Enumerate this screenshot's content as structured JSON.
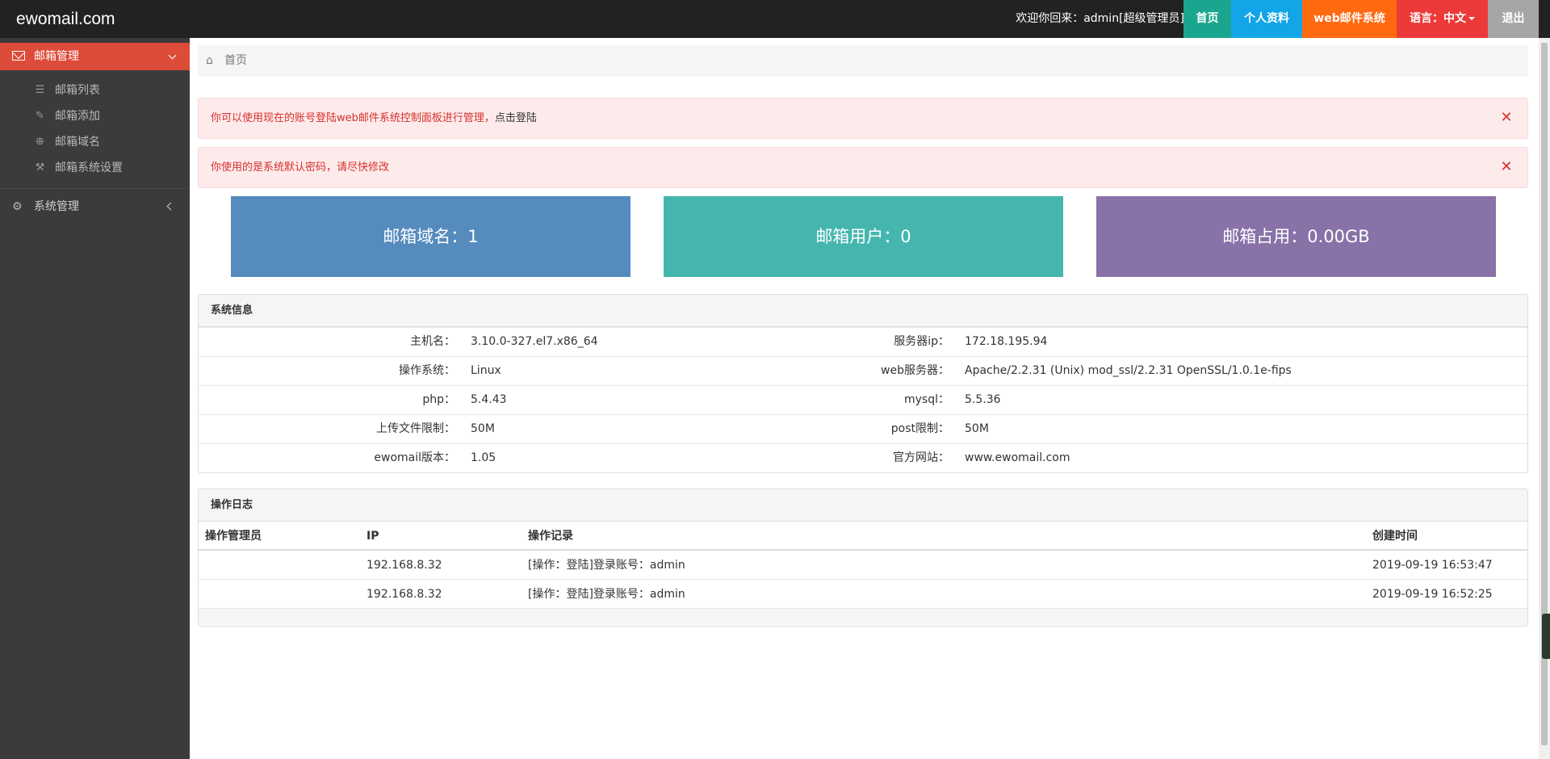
{
  "brand": "ewomail.com",
  "welcome": "欢迎你回来：admin[超级管理员]",
  "nav": {
    "home": "首页",
    "profile": "个人资料",
    "web": "web邮件系统",
    "lang": "语言：中文",
    "logout": "退出"
  },
  "sidebar": {
    "group_mail": "邮箱管理",
    "items": [
      {
        "label": "邮箱列表",
        "icon": "list-icon"
      },
      {
        "label": "邮箱添加",
        "icon": "pencil-icon"
      },
      {
        "label": "邮箱域名",
        "icon": "globe-icon"
      },
      {
        "label": "邮箱系统设置",
        "icon": "wrench-icon"
      }
    ],
    "group_system": "系统管理"
  },
  "breadcrumb": "首页",
  "alerts": {
    "a1": "你可以使用现在的账号登陆web邮件系统控制面板进行管理，",
    "a1_link": "点击登陆",
    "a2": "你使用的是系统默认密码，请尽快修改"
  },
  "stats": {
    "domains": "邮箱域名：1",
    "users": "邮箱用户：0",
    "usage": "邮箱占用：0.00GB"
  },
  "system": {
    "title": "系统信息",
    "rows": [
      {
        "k1": "主机名：",
        "v1": "3.10.0-327.el7.x86_64",
        "k2": "服务器ip：",
        "v2": "172.18.195.94"
      },
      {
        "k1": "操作系统：",
        "v1": "Linux",
        "k2": "web服务器：",
        "v2": "Apache/2.2.31 (Unix) mod_ssl/2.2.31 OpenSSL/1.0.1e-fips"
      },
      {
        "k1": "php：",
        "v1": "5.4.43",
        "k2": "mysql：",
        "v2": "5.5.36"
      },
      {
        "k1": "上传文件限制：",
        "v1": "50M",
        "k2": "post限制：",
        "v2": "50M"
      },
      {
        "k1": "ewomail版本：",
        "v1": "1.05",
        "k2": "官方网站：",
        "v2": "www.ewomail.com"
      }
    ]
  },
  "log": {
    "title": "操作日志",
    "headers": [
      "操作管理员",
      "IP",
      "操作记录",
      "创建时间"
    ],
    "rows": [
      [
        "",
        "192.168.8.32",
        "[操作：登陆]登录账号：admin",
        "2019-09-19 16:53:47"
      ],
      [
        "",
        "192.168.8.32",
        "[操作：登陆]登录账号：admin",
        "2019-09-19 16:52:25"
      ]
    ]
  },
  "colors": {
    "topbar": "#222222",
    "sidebar": "#3b3b3b",
    "sidebar_active": "#dd4b39",
    "nav_home": "#1aa68e",
    "nav_profile": "#12a5e8",
    "nav_web": "#ff6a11",
    "nav_lang": "#ec3a3a",
    "nav_logout": "#a6a6a6",
    "stat_domains": "#558bbd",
    "stat_users": "#45b6ae",
    "stat_usage": "#8872a8"
  }
}
